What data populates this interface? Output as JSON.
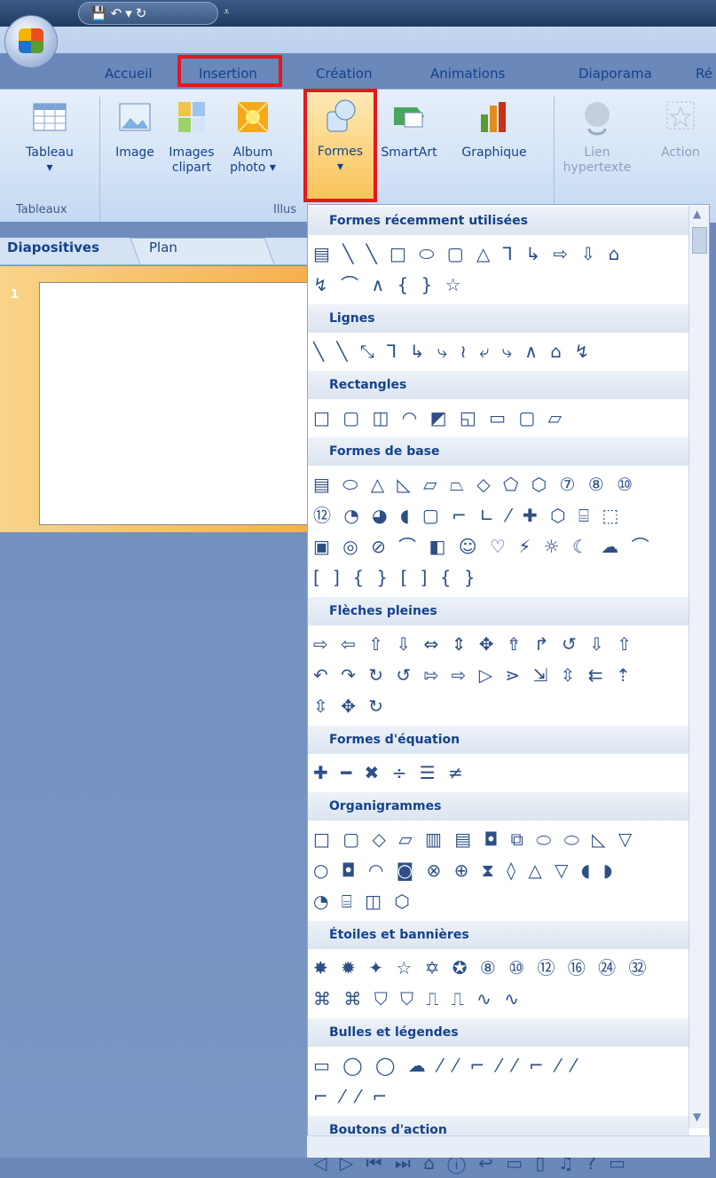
{
  "qat": {
    "save_icon": "save-icon",
    "undo_icon": "undo-icon",
    "redo_icon": "redo-icon",
    "more": "⩡"
  },
  "tabs": [
    {
      "label": "Accueil"
    },
    {
      "label": "Insertion"
    },
    {
      "label": "Création"
    },
    {
      "label": "Animations"
    },
    {
      "label": "Diaporama"
    },
    {
      "label": "Ré"
    }
  ],
  "ribbon": {
    "tableau": {
      "label": "Tableau",
      "arrow": "▾"
    },
    "image": {
      "label": "Image"
    },
    "images_clipart": {
      "label1": "Images",
      "label2": "clipart"
    },
    "album": {
      "label1": "Album",
      "label2": "photo ▾"
    },
    "formes": {
      "label": "Formes",
      "arrow": "▾"
    },
    "smartart": {
      "label": "SmartArt"
    },
    "graphique": {
      "label": "Graphique"
    },
    "lien": {
      "label1": "Lien",
      "label2": "hypertexte"
    },
    "action": {
      "label": "Action"
    },
    "groups": {
      "tableaux": "Tableaux",
      "illus": "Illus"
    }
  },
  "pane": {
    "tab_diapos": "Diapositives",
    "tab_plan": "Plan",
    "slide_number": "1"
  },
  "dropdown": {
    "sections": [
      {
        "title": "Formes récemment utilisées",
        "rows": [
          "▤ ╲ ╲ □ ⬭ ▢ △ ⅂ ↳ ⇨ ⇩ ⌂",
          "↯ ⌒ ∧ { } ☆"
        ]
      },
      {
        "title": "Lignes",
        "rows": [
          "╲ ╲ ⤡ ⅂ ↳ ⤷ ≀ ⤶ ⤷ ∧ ⌂ ↯"
        ]
      },
      {
        "title": "Rectangles",
        "rows": [
          "□ ▢ ◫ ◠ ◩ ◱ ▭ ▢ ▱"
        ]
      },
      {
        "title": "Formes de base",
        "rows": [
          "▤ ⬭ △ ◺ ▱ ⏢ ◇ ⬠ ⬡ ⑦ ⑧ ⑩",
          "⑫ ◔ ◕ ◖ ▢ ⌐ ∟ ⁄ ✚ ⬡ ⌸ ⬚",
          "▣ ◎ ⊘ ⌒ ◧ ☺ ♡ ⚡ ☼ ☾ ☁ ⌒",
          "[ ] { } [ ] { }"
        ]
      },
      {
        "title": "Flèches pleines",
        "rows": [
          "⇨ ⇦ ⇧ ⇩ ⇔ ⇕ ✥ ⇮ ↱ ↺ ⇩ ⇧",
          "↶ ↷ ↻ ↺ ⇰ ⇨ ▷ ⋗ ⇲ ⇳ ⇇ ⇡",
          "⇳ ✥ ↻"
        ]
      },
      {
        "title": "Formes d'équation",
        "rows": [
          "✚ ━ ✖ ÷ ☰ ≠"
        ]
      },
      {
        "title": "Organigrammes",
        "rows": [
          "□ ▢ ◇ ▱ ▥ ▤ ◘ ⧉ ⬭ ⬭ ◺ ▽",
          "○ ◘ ◠ ◙ ⊗ ⊕ ⧗ ◊ △ ▽ ◖ ◗",
          "◔ ⌸ ◫ ⬡"
        ]
      },
      {
        "title": "Étoiles et bannières",
        "rows": [
          "✸ ✹ ✦ ☆ ✡ ✪ ⑧ ⑩ ⑫ ⑯ ㉔ ㉜",
          "⌘ ⌘ ⛉ ⛉ ⎍ ⎍ ∿ ∿"
        ]
      },
      {
        "title": "Bulles et légendes",
        "rows": [
          "▭ ◯ ◯ ☁ ⁄ ⁄ ⌐ ⁄ ⁄ ⌐ ⁄ ⁄",
          "⌐ ⁄ ⁄ ⌐"
        ]
      },
      {
        "title": "Boutons d'action",
        "rows": [
          "◁ ▷ ⏮ ⏭ ⌂ ⓘ ↩ ▭ ▯ ♫ ? ▭"
        ]
      }
    ]
  }
}
